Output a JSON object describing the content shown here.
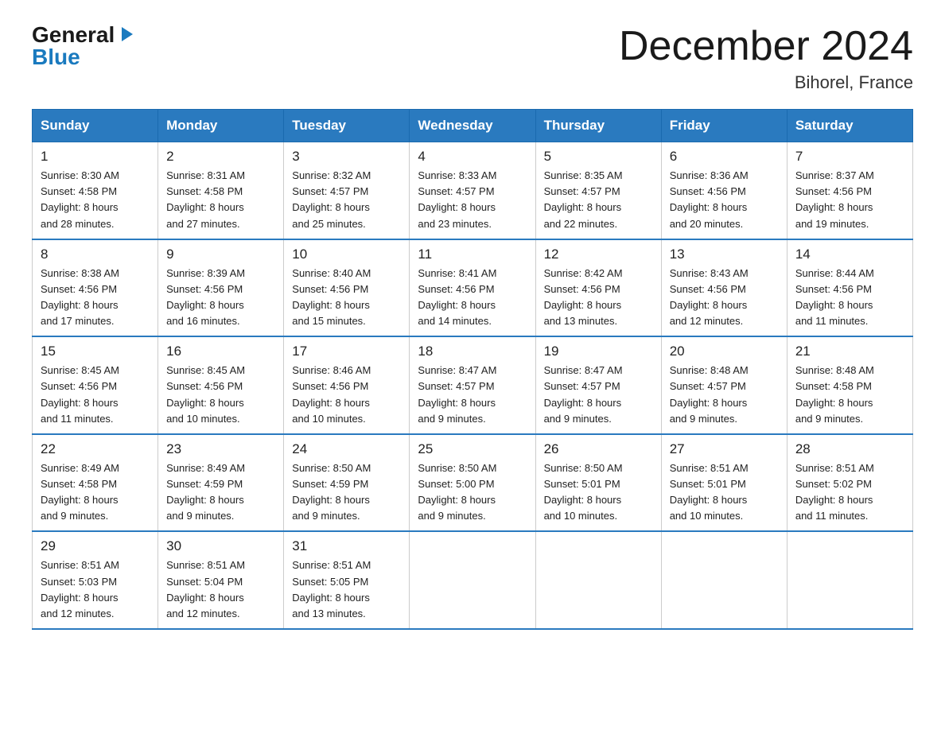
{
  "logo": {
    "general": "General",
    "blue": "Blue"
  },
  "title": "December 2024",
  "subtitle": "Bihorel, France",
  "headers": [
    "Sunday",
    "Monday",
    "Tuesday",
    "Wednesday",
    "Thursday",
    "Friday",
    "Saturday"
  ],
  "weeks": [
    [
      {
        "day": "1",
        "sunrise": "8:30 AM",
        "sunset": "4:58 PM",
        "daylight": "8 hours and 28 minutes."
      },
      {
        "day": "2",
        "sunrise": "8:31 AM",
        "sunset": "4:58 PM",
        "daylight": "8 hours and 27 minutes."
      },
      {
        "day": "3",
        "sunrise": "8:32 AM",
        "sunset": "4:57 PM",
        "daylight": "8 hours and 25 minutes."
      },
      {
        "day": "4",
        "sunrise": "8:33 AM",
        "sunset": "4:57 PM",
        "daylight": "8 hours and 23 minutes."
      },
      {
        "day": "5",
        "sunrise": "8:35 AM",
        "sunset": "4:57 PM",
        "daylight": "8 hours and 22 minutes."
      },
      {
        "day": "6",
        "sunrise": "8:36 AM",
        "sunset": "4:56 PM",
        "daylight": "8 hours and 20 minutes."
      },
      {
        "day": "7",
        "sunrise": "8:37 AM",
        "sunset": "4:56 PM",
        "daylight": "8 hours and 19 minutes."
      }
    ],
    [
      {
        "day": "8",
        "sunrise": "8:38 AM",
        "sunset": "4:56 PM",
        "daylight": "8 hours and 17 minutes."
      },
      {
        "day": "9",
        "sunrise": "8:39 AM",
        "sunset": "4:56 PM",
        "daylight": "8 hours and 16 minutes."
      },
      {
        "day": "10",
        "sunrise": "8:40 AM",
        "sunset": "4:56 PM",
        "daylight": "8 hours and 15 minutes."
      },
      {
        "day": "11",
        "sunrise": "8:41 AM",
        "sunset": "4:56 PM",
        "daylight": "8 hours and 14 minutes."
      },
      {
        "day": "12",
        "sunrise": "8:42 AM",
        "sunset": "4:56 PM",
        "daylight": "8 hours and 13 minutes."
      },
      {
        "day": "13",
        "sunrise": "8:43 AM",
        "sunset": "4:56 PM",
        "daylight": "8 hours and 12 minutes."
      },
      {
        "day": "14",
        "sunrise": "8:44 AM",
        "sunset": "4:56 PM",
        "daylight": "8 hours and 11 minutes."
      }
    ],
    [
      {
        "day": "15",
        "sunrise": "8:45 AM",
        "sunset": "4:56 PM",
        "daylight": "8 hours and 11 minutes."
      },
      {
        "day": "16",
        "sunrise": "8:45 AM",
        "sunset": "4:56 PM",
        "daylight": "8 hours and 10 minutes."
      },
      {
        "day": "17",
        "sunrise": "8:46 AM",
        "sunset": "4:56 PM",
        "daylight": "8 hours and 10 minutes."
      },
      {
        "day": "18",
        "sunrise": "8:47 AM",
        "sunset": "4:57 PM",
        "daylight": "8 hours and 9 minutes."
      },
      {
        "day": "19",
        "sunrise": "8:47 AM",
        "sunset": "4:57 PM",
        "daylight": "8 hours and 9 minutes."
      },
      {
        "day": "20",
        "sunrise": "8:48 AM",
        "sunset": "4:57 PM",
        "daylight": "8 hours and 9 minutes."
      },
      {
        "day": "21",
        "sunrise": "8:48 AM",
        "sunset": "4:58 PM",
        "daylight": "8 hours and 9 minutes."
      }
    ],
    [
      {
        "day": "22",
        "sunrise": "8:49 AM",
        "sunset": "4:58 PM",
        "daylight": "8 hours and 9 minutes."
      },
      {
        "day": "23",
        "sunrise": "8:49 AM",
        "sunset": "4:59 PM",
        "daylight": "8 hours and 9 minutes."
      },
      {
        "day": "24",
        "sunrise": "8:50 AM",
        "sunset": "4:59 PM",
        "daylight": "8 hours and 9 minutes."
      },
      {
        "day": "25",
        "sunrise": "8:50 AM",
        "sunset": "5:00 PM",
        "daylight": "8 hours and 9 minutes."
      },
      {
        "day": "26",
        "sunrise": "8:50 AM",
        "sunset": "5:01 PM",
        "daylight": "8 hours and 10 minutes."
      },
      {
        "day": "27",
        "sunrise": "8:51 AM",
        "sunset": "5:01 PM",
        "daylight": "8 hours and 10 minutes."
      },
      {
        "day": "28",
        "sunrise": "8:51 AM",
        "sunset": "5:02 PM",
        "daylight": "8 hours and 11 minutes."
      }
    ],
    [
      {
        "day": "29",
        "sunrise": "8:51 AM",
        "sunset": "5:03 PM",
        "daylight": "8 hours and 12 minutes."
      },
      {
        "day": "30",
        "sunrise": "8:51 AM",
        "sunset": "5:04 PM",
        "daylight": "8 hours and 12 minutes."
      },
      {
        "day": "31",
        "sunrise": "8:51 AM",
        "sunset": "5:05 PM",
        "daylight": "8 hours and 13 minutes."
      },
      null,
      null,
      null,
      null
    ]
  ],
  "labels": {
    "sunrise": "Sunrise:",
    "sunset": "Sunset:",
    "daylight": "Daylight:"
  }
}
